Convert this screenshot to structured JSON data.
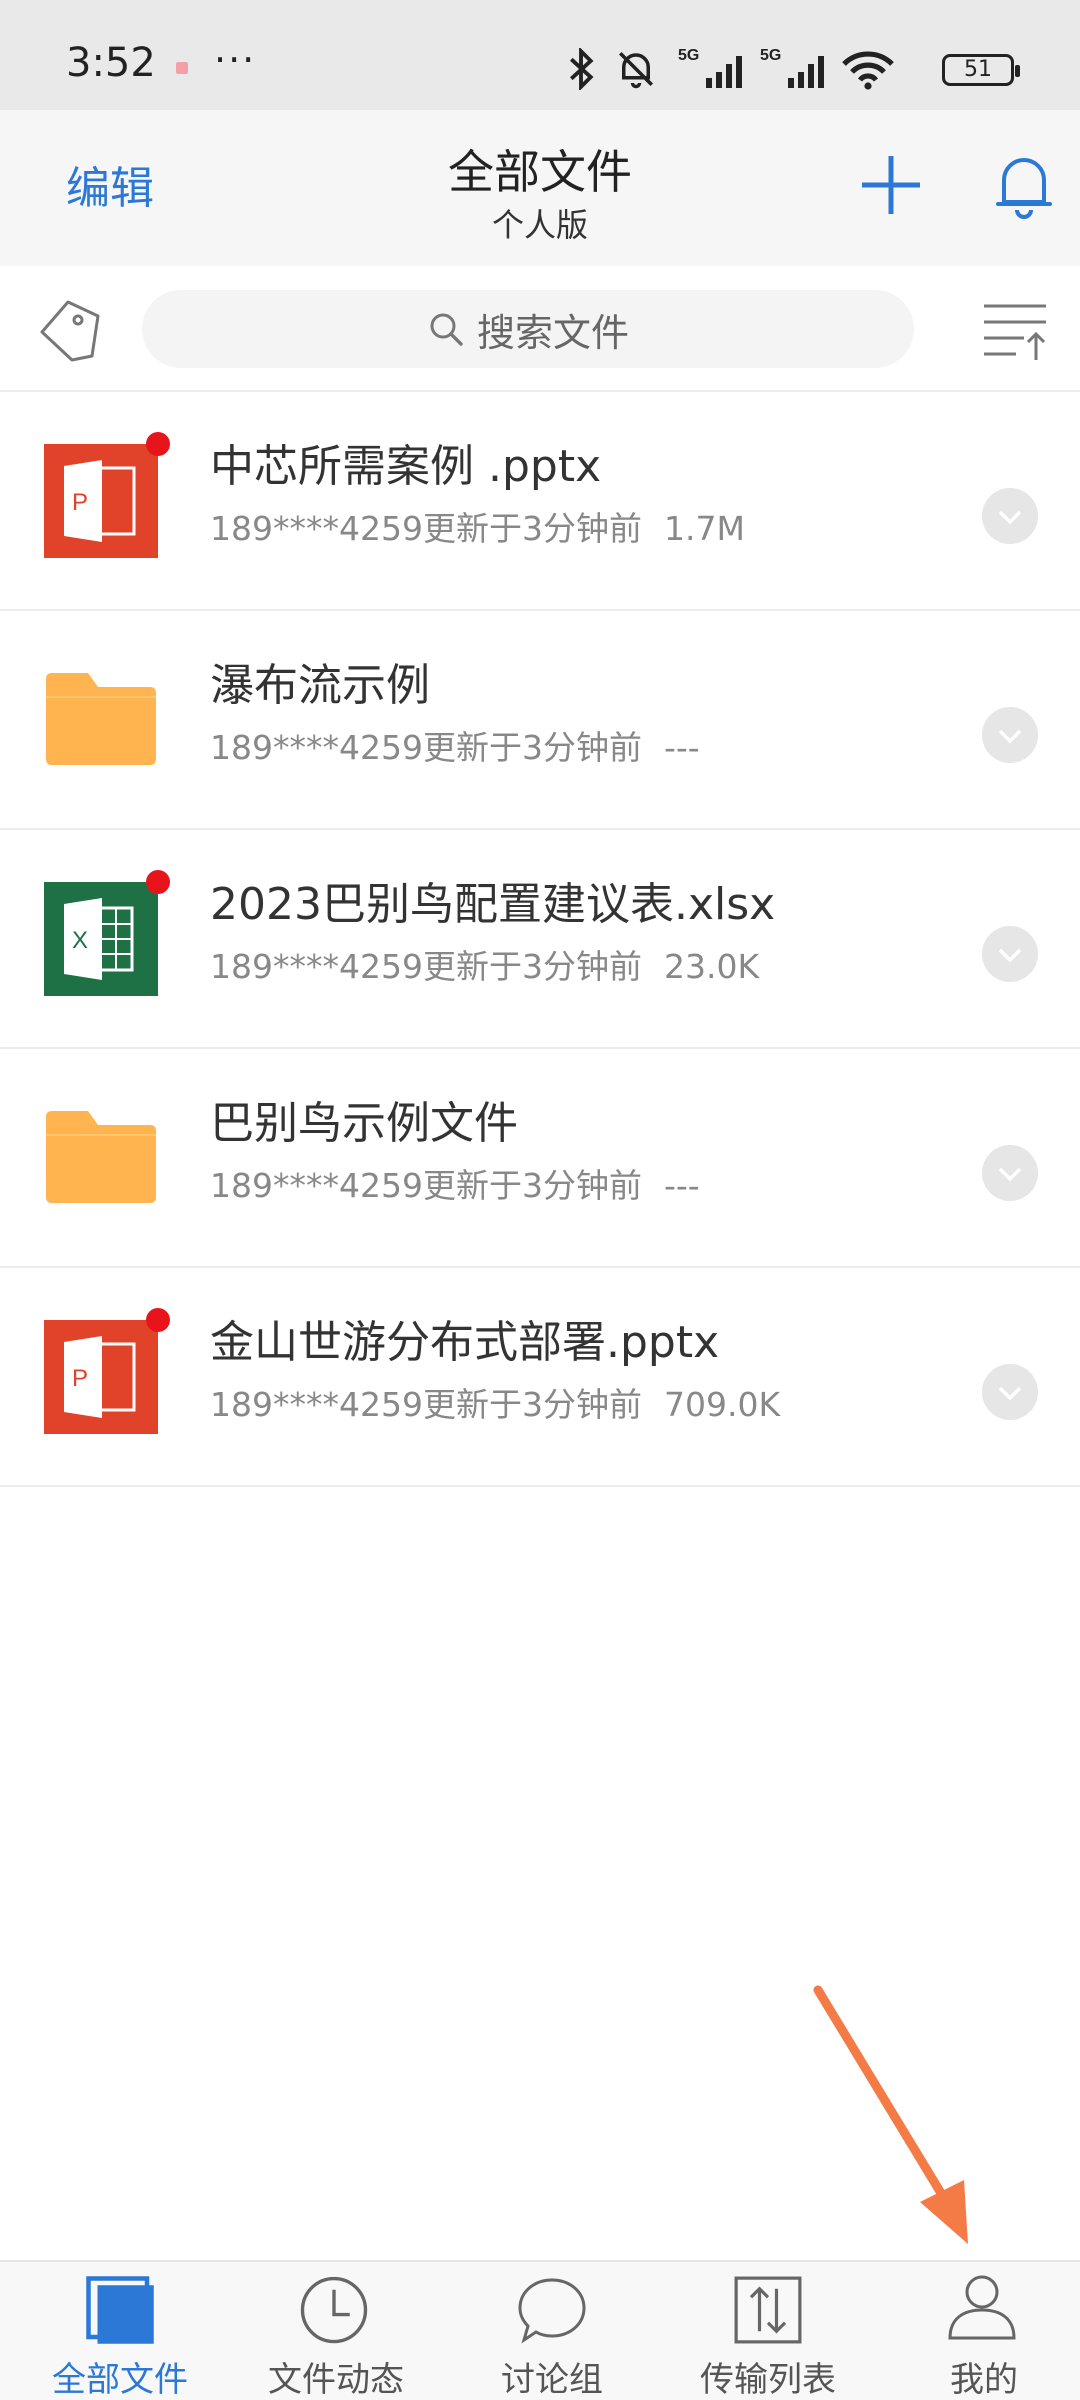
{
  "status_bar": {
    "time": "3:52",
    "more": "···",
    "battery": "51",
    "icons": [
      "bluetooth-icon",
      "mute-icon",
      "signal-5g-icon",
      "signal-5g-icon",
      "wifi-icon",
      "battery-icon"
    ]
  },
  "header": {
    "edit_label": "编辑",
    "title": "全部文件",
    "subtitle": "个人版"
  },
  "search": {
    "placeholder": "搜索文件"
  },
  "files": [
    {
      "name": "中芯所需案例 .pptx",
      "owner": "189****4259",
      "updated": "更新于3分钟前",
      "size": "1.7M",
      "type": "pptx",
      "unread": true
    },
    {
      "name": "瀑布流示例",
      "owner": "189****4259",
      "updated": "更新于3分钟前",
      "size": "---",
      "type": "folder",
      "unread": false
    },
    {
      "name": "2023巴别鸟配置建议表.xlsx",
      "owner": "189****4259",
      "updated": "更新于3分钟前",
      "size": "23.0K",
      "type": "xlsx",
      "unread": true
    },
    {
      "name": "巴别鸟示例文件",
      "owner": "189****4259",
      "updated": "更新于3分钟前",
      "size": "---",
      "type": "folder",
      "unread": false
    },
    {
      "name": "金山世游分布式部署.pptx",
      "owner": "189****4259",
      "updated": "更新于3分钟前",
      "size": "709.0K",
      "type": "pptx",
      "unread": true
    }
  ],
  "bottom_nav": [
    {
      "label": "全部文件",
      "icon": "files-icon",
      "active": true
    },
    {
      "label": "文件动态",
      "icon": "clock-icon",
      "active": false
    },
    {
      "label": "讨论组",
      "icon": "chat-icon",
      "active": false
    },
    {
      "label": "传输列表",
      "icon": "transfer-icon",
      "active": false
    },
    {
      "label": "我的",
      "icon": "user-icon",
      "active": false
    }
  ],
  "colors": {
    "accent": "#2b78d6",
    "ppt": "#e1432a",
    "xls": "#1e7145",
    "folder": "#ffb44f",
    "unread": "#e8141c",
    "annotation_arrow": "#f47b45"
  }
}
